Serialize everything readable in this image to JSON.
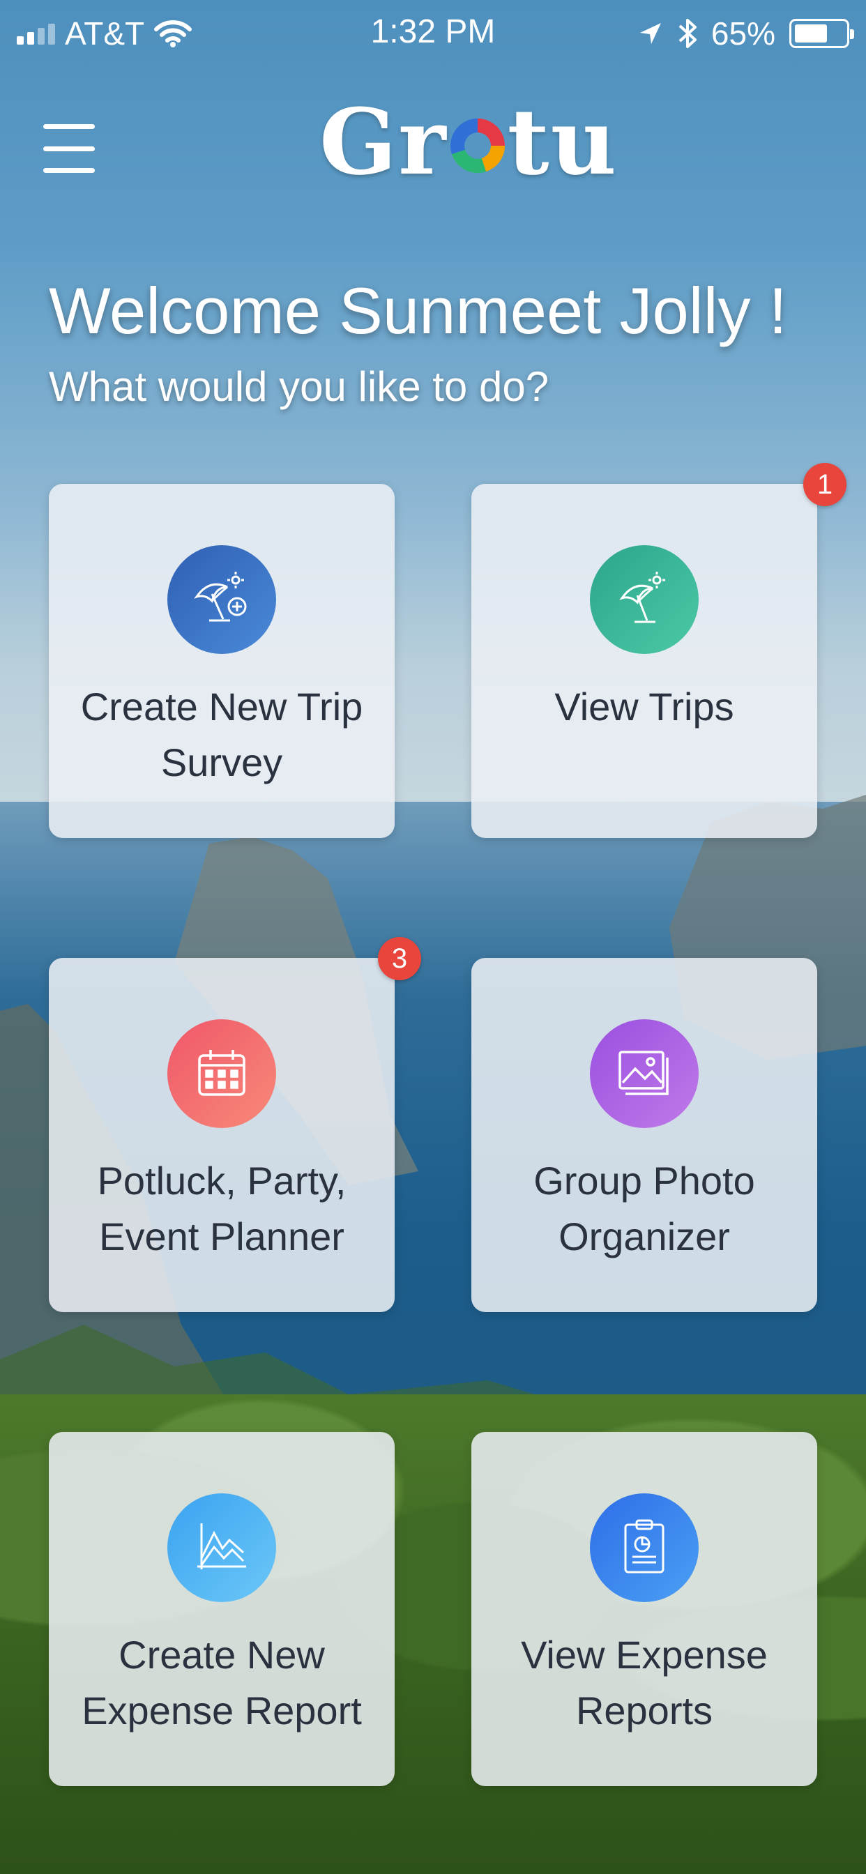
{
  "status_bar": {
    "carrier": "AT&T",
    "time": "1:32 PM",
    "battery": "65%",
    "battery_level": 0.65,
    "icons": [
      "signal-icon",
      "wifi-icon",
      "location-icon",
      "bluetooth-icon",
      "battery-icon"
    ]
  },
  "header": {
    "logo_text_left": "Gr",
    "logo_text_right": "tu",
    "menu_icon": "hamburger-menu-icon"
  },
  "welcome": {
    "title": "Welcome Sunmeet Jolly !",
    "subtitle": "What would you like to do?"
  },
  "tiles": [
    {
      "label": "Create New Trip\nSurvey",
      "icon": "beach-umbrella-plus-icon",
      "color_from": "#2f5fb3",
      "color_to": "#4a8ad8"
    },
    {
      "label": "View Trips",
      "icon": "beach-umbrella-icon",
      "color_from": "#2ca58b",
      "color_to": "#4cc9a6",
      "badge": "1"
    },
    {
      "label": "Potluck, Party,\nEvent Planner",
      "icon": "calendar-icon",
      "color_from": "#f0576a",
      "color_to": "#f78a78"
    },
    {
      "label": "Group Photo\nOrganizer",
      "icon": "photo-gallery-icon",
      "color_from": "#9a4fe0",
      "color_to": "#c07ae8"
    },
    {
      "label": "Create New\nExpense Report",
      "icon": "chart-report-icon",
      "color_from": "#3aa3f0",
      "color_to": "#6cc7f7"
    },
    {
      "label": "View Expense\nReports",
      "icon": "clipboard-report-icon",
      "color_from": "#2e6ee8",
      "color_to": "#4aa0f4"
    }
  ],
  "badges": {
    "view_trips": "1",
    "event_planner": "3"
  },
  "colors": {
    "badge": "#e8453c",
    "text": "#2a3240",
    "tile_bg": "#ecf0f4"
  }
}
